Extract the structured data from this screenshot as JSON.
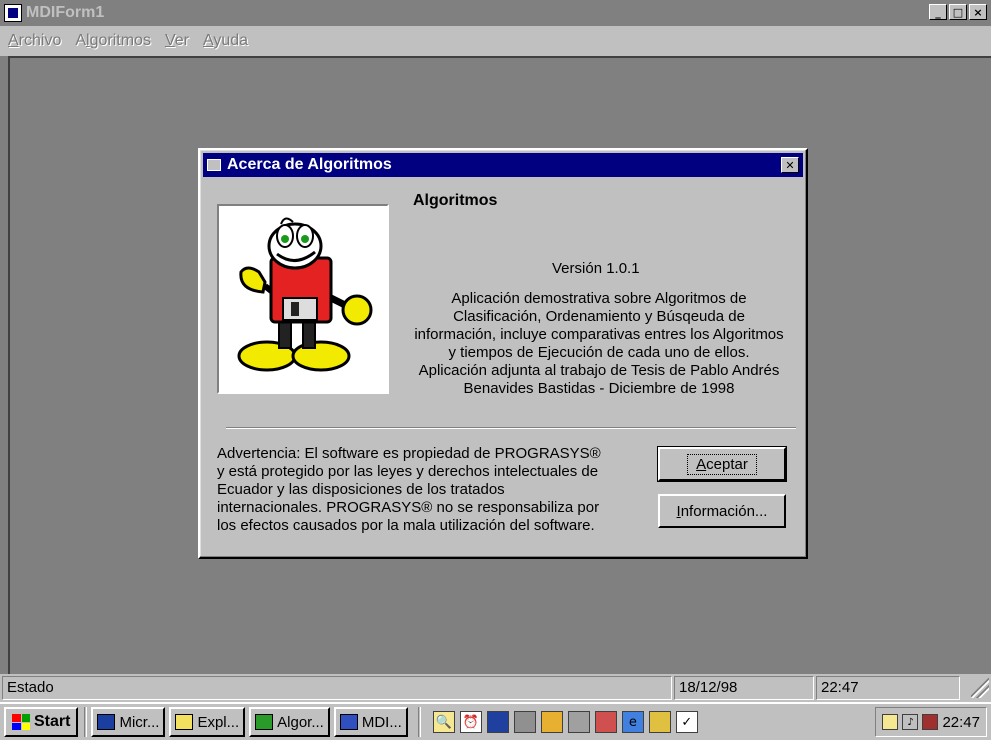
{
  "main_window": {
    "title": "MDIForm1",
    "controls": [
      "_",
      "□",
      "×"
    ]
  },
  "menu": {
    "items": [
      {
        "label_underlined": "A",
        "label_rest": "rchivo"
      },
      {
        "label_underlined": "l",
        "label_prefix": "A",
        "label_rest": "goritmos"
      },
      {
        "label_underlined": "V",
        "label_rest": "er"
      },
      {
        "label_underlined": "A",
        "label_rest": "yuda"
      }
    ]
  },
  "dialog": {
    "title": "Acerca de Algoritmos",
    "app_name": "Algoritmos",
    "version": "Versión 1.0.1",
    "description": [
      "Aplicación demostrativa sobre Algoritmos de",
      "Clasificación, Ordenamiento y Búsqeuda de",
      "información, incluye comparativas entres los Algoritmos",
      "y tiempos de Ejecución de cada uno de ellos.",
      "Aplicación adjunta al trabajo de Tesis de Pablo Andrés",
      "Benavides Bastidas - Diciembre de 1998"
    ],
    "warning": [
      "Advertencia: El software es propiedad de PROGRASYS®",
      "y está protegido por las leyes y derechos intelectuales de",
      "Ecuador y las disposiciones  de los tratados",
      "internacionales. PROGRASYS® no se responsabiliza por",
      "los efectos causados por la mala utilización del software."
    ],
    "accept_button": {
      "underlined": "A",
      "rest": "ceptar"
    },
    "info_button": {
      "underlined": "I",
      "rest": "nformación..."
    }
  },
  "statusbar": {
    "status": "Estado",
    "date": "18/12/98",
    "time": "22:47"
  },
  "taskbar": {
    "start": "Start",
    "tasks": [
      {
        "label": "Micr...",
        "icon": "word-icon"
      },
      {
        "label": "Expl...",
        "icon": "explorer-icon"
      },
      {
        "label": "Algor...",
        "icon": "app-icon"
      },
      {
        "label": "MDI...",
        "icon": "app-icon"
      }
    ],
    "quick_launch_icons": [
      "find-icon",
      "clock-icon",
      "monitor-icon",
      "network-icon",
      "house-icon",
      "tools-icon",
      "chart-icon",
      "ie-icon",
      "folder-icon",
      "checklist-icon"
    ],
    "tray_time": "22:47"
  }
}
